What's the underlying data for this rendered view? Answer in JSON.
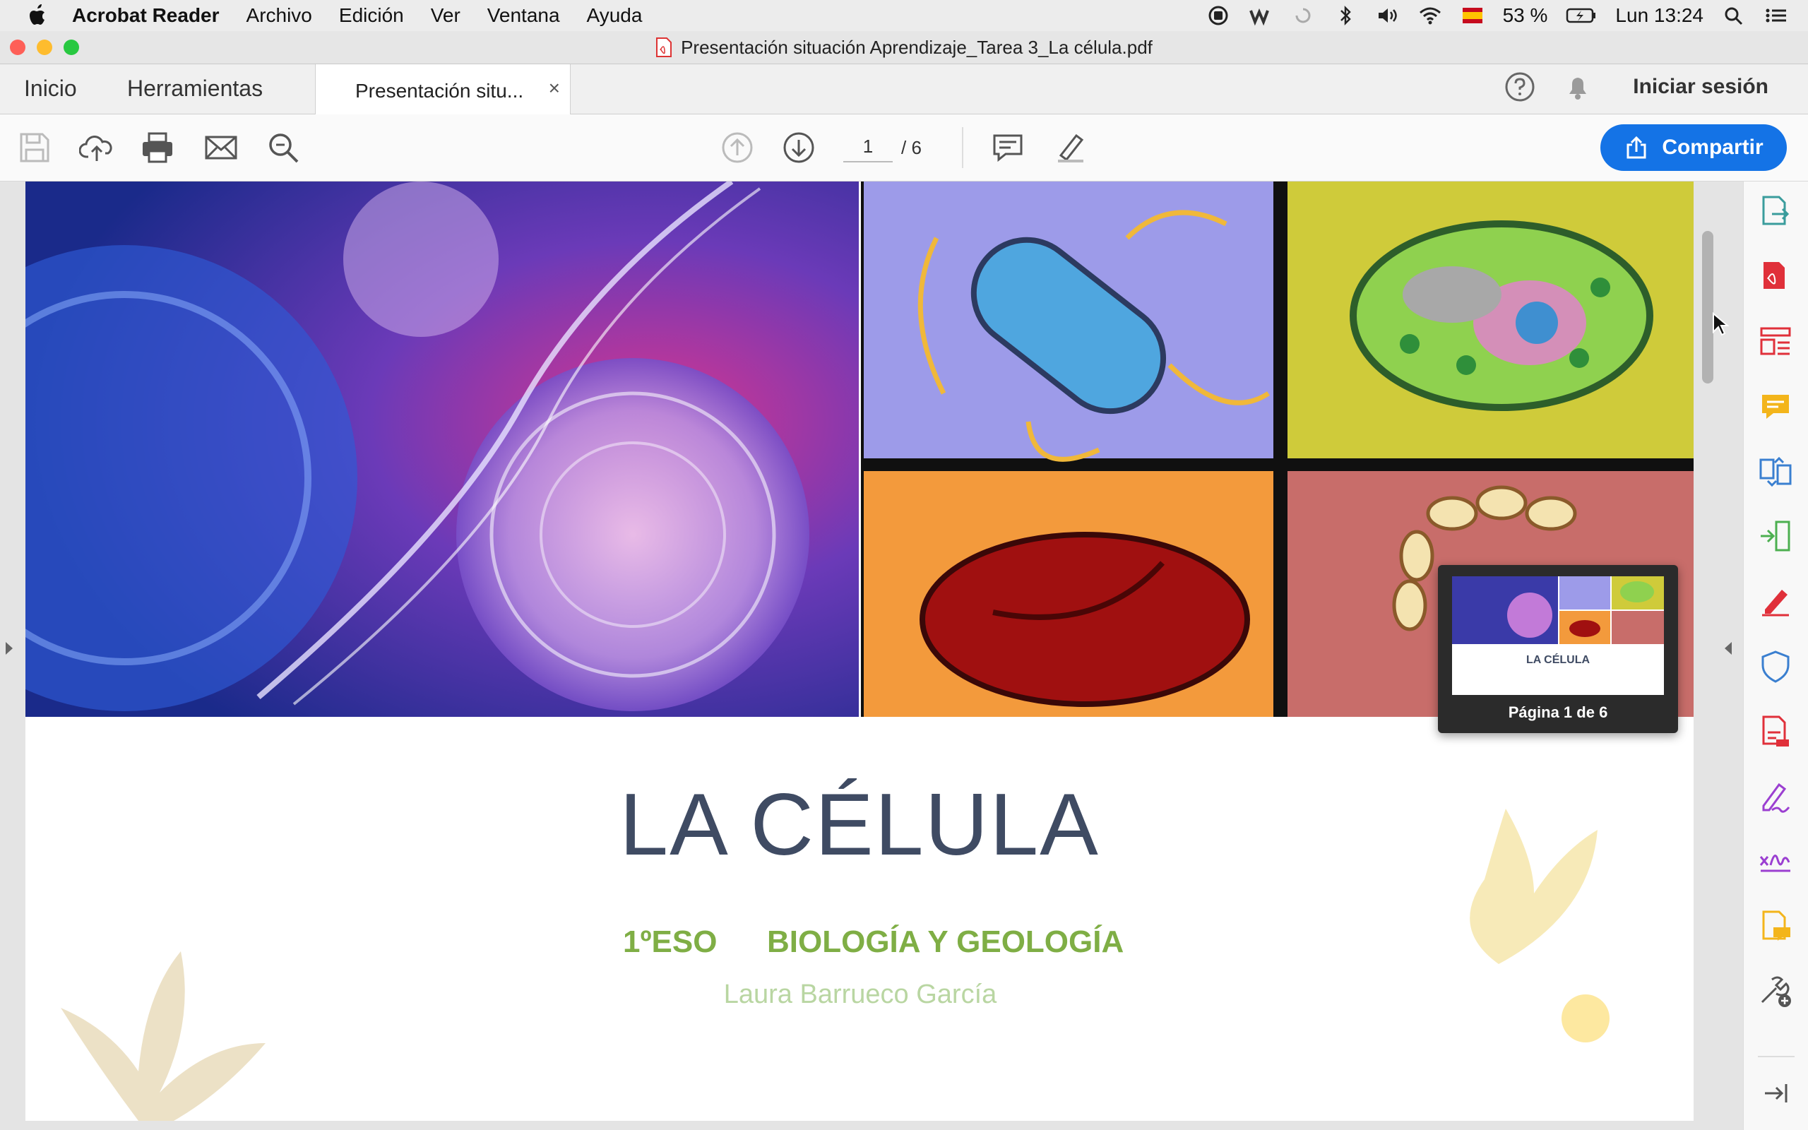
{
  "menubar": {
    "app_name": "Acrobat Reader",
    "items": [
      "Archivo",
      "Edición",
      "Ver",
      "Ventana",
      "Ayuda"
    ],
    "battery": "53 %",
    "clock": "Lun 13:24"
  },
  "window": {
    "title": "Presentación situación Aprendizaje_Tarea 3_La célula.pdf"
  },
  "tabs": {
    "home": "Inicio",
    "tools": "Herramientas",
    "document_tab": "Presentación situ...",
    "close_glyph": "×",
    "sign_in": "Iniciar sesión"
  },
  "toolbar": {
    "current_page": "1",
    "total_pages": "/ 6",
    "share_label": "Compartir"
  },
  "thumbnail_popup": {
    "label": "Página 1 de 6",
    "mini_title": "LA CÉLULA"
  },
  "document": {
    "title": "LA CÉLULA",
    "course": "1ºESO",
    "subject": "BIOLOGÍA Y GEOLOGÍA",
    "author": "Laura Barrueco García"
  },
  "colors": {
    "accent": "#1473e6",
    "title": "#3f4b63",
    "subtitle": "#7fae45",
    "author": "#b9d6a2",
    "tool_red": "#e0303a",
    "tool_blue": "#3a7fd0",
    "tool_yellow": "#f3b51b",
    "tool_green": "#4caf50",
    "tool_purple": "#9b3fd1"
  },
  "icons": {
    "right_panel": [
      "export-pdf-icon",
      "create-pdf-icon",
      "organize-pages-icon",
      "comment-icon",
      "combine-files-icon",
      "compress-icon",
      "edit-pdf-icon",
      "protect-icon",
      "pdf-convert-icon",
      "fill-sign-icon",
      "request-signature-icon",
      "send-comments-icon",
      "more-tools-icon",
      "collapse-panel-icon"
    ]
  }
}
